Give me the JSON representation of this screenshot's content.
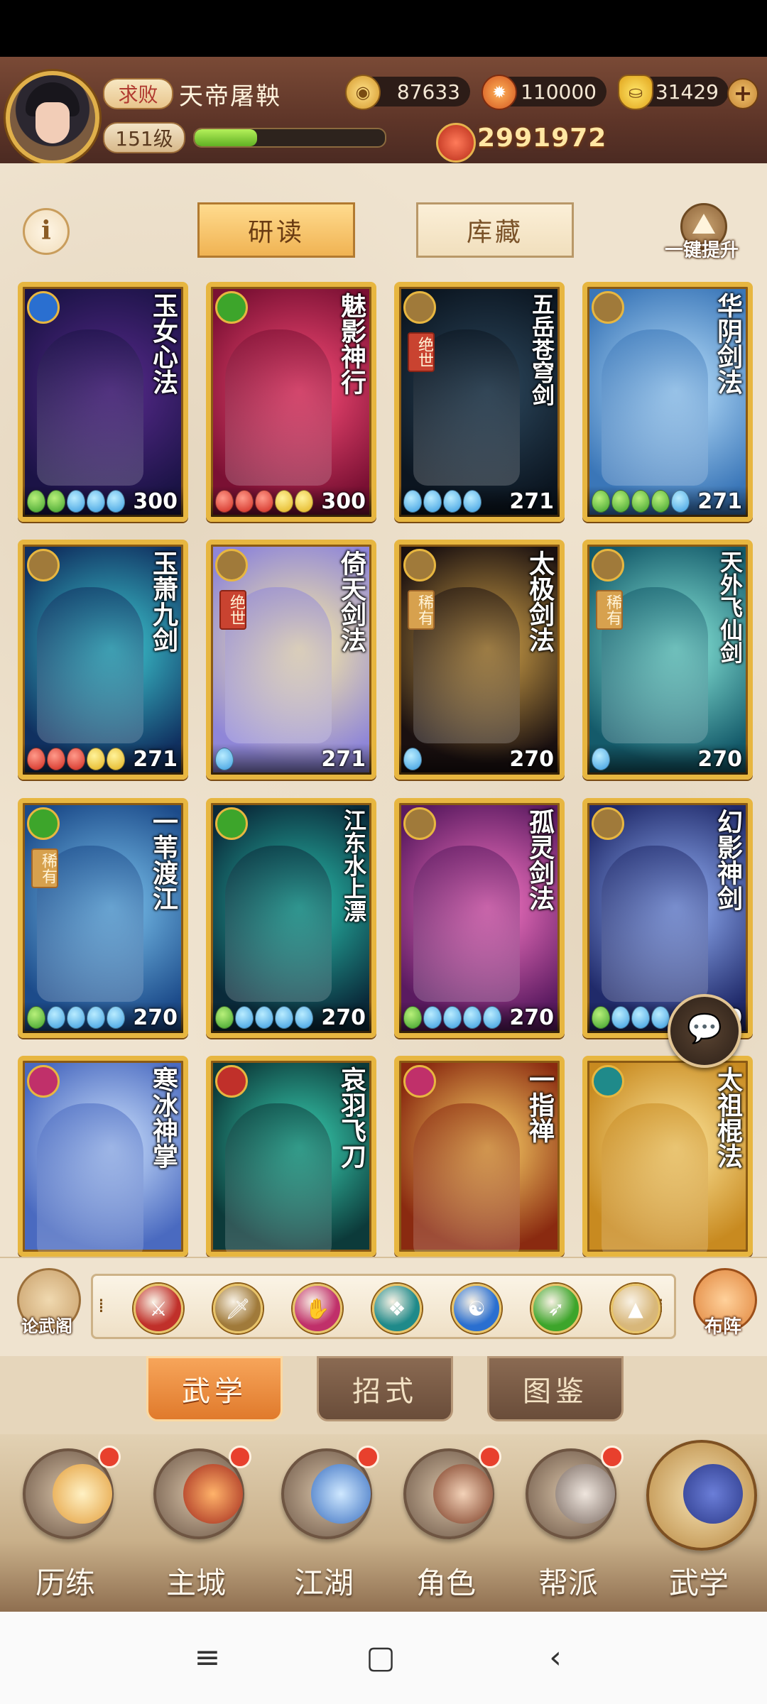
{
  "player": {
    "rank_title": "求败",
    "name": "天帝屠鞅",
    "level": "151级",
    "xp_progress": 0.33,
    "power": "2991972"
  },
  "resources": {
    "coins": "87633",
    "embers": "110000",
    "ingots": "31429"
  },
  "tabs_top": {
    "study": "研读",
    "storage": "库藏",
    "upgrade_all": "一键提升"
  },
  "cards": [
    {
      "title": "玉女心法",
      "tag": "",
      "pips": [
        "g",
        "g",
        "b",
        "b",
        "b"
      ],
      "score": "300",
      "icon_color": "#2a6fd0",
      "bg": [
        "#5a2b8f",
        "#1b1346"
      ]
    },
    {
      "title": "魅影神行",
      "tag": "",
      "pips": [
        "r",
        "r",
        "r",
        "y",
        "y"
      ],
      "score": "300",
      "icon_color": "#3da52b",
      "bg": [
        "#ff4e7a",
        "#7a1033"
      ]
    },
    {
      "title": "五岳苍穹剑",
      "tag": "绝世",
      "pips": [
        "b",
        "b",
        "b",
        "b"
      ],
      "score": "271",
      "icon_color": "#a07a3a",
      "bg": [
        "#2e4a60",
        "#0b1520"
      ]
    },
    {
      "title": "华阴剑法",
      "tag": "",
      "pips": [
        "g",
        "g",
        "g",
        "g",
        "b"
      ],
      "score": "271",
      "icon_color": "#a07a3a",
      "bg": [
        "#bfe5ff",
        "#3a76b8"
      ]
    },
    {
      "title": "玉萧九剑",
      "tag": "",
      "pips": [
        "r",
        "r",
        "r",
        "y",
        "y"
      ],
      "score": "271",
      "icon_color": "#a07a3a",
      "bg": [
        "#3fd0d6",
        "#103060"
      ]
    },
    {
      "title": "倚天剑法",
      "tag": "绝世",
      "pips": [
        "b"
      ],
      "score": "271",
      "icon_color": "#a07a3a",
      "bg": [
        "#fff0a0",
        "#8f86d8"
      ]
    },
    {
      "title": "太极剑法",
      "tag": "稀有",
      "pips": [
        "b"
      ],
      "score": "270",
      "icon_color": "#a07a3a",
      "bg": [
        "#d9a84a",
        "#1a1010"
      ]
    },
    {
      "title": "天外飞仙剑",
      "tag": "稀有",
      "pips": [
        "b"
      ],
      "score": "270",
      "icon_color": "#a07a3a",
      "bg": [
        "#8ff0e0",
        "#145a6a"
      ]
    },
    {
      "title": "一苇渡江",
      "tag": "稀有",
      "pips": [
        "g",
        "b",
        "b",
        "b",
        "b"
      ],
      "score": "270",
      "icon_color": "#3da52b",
      "bg": [
        "#7fc8f2",
        "#1c4b8a"
      ]
    },
    {
      "title": "江东水上漂",
      "tag": "",
      "pips": [
        "g",
        "b",
        "b",
        "b",
        "b"
      ],
      "score": "270",
      "icon_color": "#3da52b",
      "bg": [
        "#2ac4b0",
        "#0a2a3a"
      ]
    },
    {
      "title": "孤灵剑法",
      "tag": "",
      "pips": [
        "g",
        "b",
        "b",
        "b",
        "b"
      ],
      "score": "270",
      "icon_color": "#a07a3a",
      "bg": [
        "#ff7ac8",
        "#5a1a60"
      ]
    },
    {
      "title": "幻影神剑",
      "tag": "",
      "pips": [
        "g",
        "b",
        "b",
        "b"
      ],
      "score": "270",
      "icon_color": "#a07a3a",
      "bg": [
        "#9ab8ff",
        "#202a6a"
      ]
    },
    {
      "title": "寒冰神掌",
      "tag": "",
      "pips": [],
      "score": "",
      "icon_color": "#c0306a",
      "bg": [
        "#cfe4ff",
        "#4a6ac0"
      ]
    },
    {
      "title": "哀羽飞刀",
      "tag": "",
      "pips": [],
      "score": "",
      "icon_color": "#c0302a",
      "bg": [
        "#3ad6b6",
        "#0c3a3a"
      ]
    },
    {
      "title": "一指禅",
      "tag": "",
      "pips": [],
      "score": "",
      "icon_color": "#c0306a",
      "bg": [
        "#ffd86a",
        "#8a2a10"
      ]
    },
    {
      "title": "太祖棍法",
      "tag": "",
      "pips": [],
      "score": "",
      "icon_color": "#1f8a8a",
      "bg": [
        "#ffe9a0",
        "#c88a20"
      ]
    }
  ],
  "filters": {
    "left_label": "论武阁",
    "right_label": "布阵",
    "icons": [
      {
        "name": "blade-filter-icon",
        "color": "#c0302a",
        "glyph": "⚔"
      },
      {
        "name": "sword-filter-icon",
        "color": "#a07a3a",
        "glyph": "🗡"
      },
      {
        "name": "palm-filter-icon",
        "color": "#c0306a",
        "glyph": "✋"
      },
      {
        "name": "fan-filter-icon",
        "color": "#1f8a8a",
        "glyph": "❖"
      },
      {
        "name": "taiji-filter-icon",
        "color": "#2a6fd0",
        "glyph": "☯"
      },
      {
        "name": "movement-filter-icon",
        "color": "#3da52b",
        "glyph": "➶"
      },
      {
        "name": "special-filter-icon",
        "color": "#d8b77a",
        "glyph": "▲"
      }
    ]
  },
  "subtabs": {
    "martial": "武学",
    "moves": "招式",
    "codex": "图鉴"
  },
  "nav": {
    "training": "历练",
    "city": "主城",
    "jianghu": "江湖",
    "role": "角色",
    "guild": "帮派",
    "martial": "武学"
  },
  "sysnav": {
    "menu": "≡",
    "home": "▢",
    "back": "‹"
  }
}
